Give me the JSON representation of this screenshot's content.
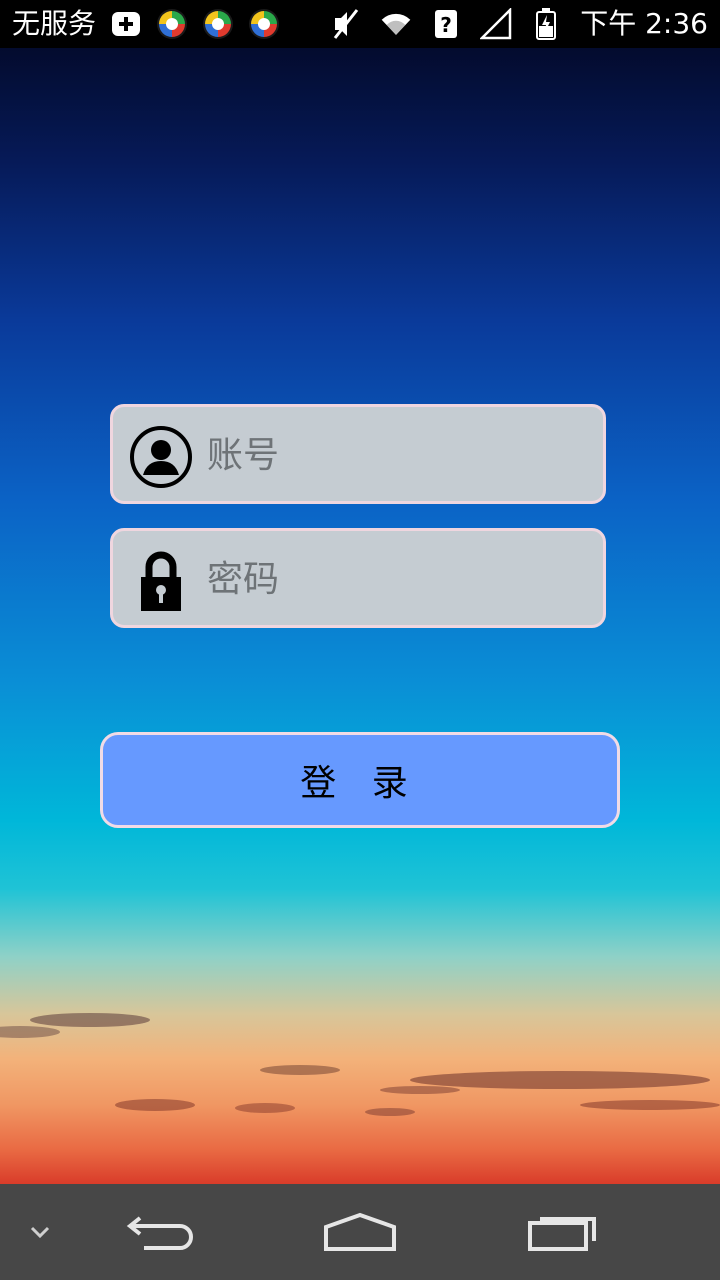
{
  "status_bar": {
    "carrier": "无服务",
    "time": "下午 2:36",
    "icons": [
      "plus-notification-icon",
      "app-icon",
      "app-icon",
      "app-icon",
      "mute-icon",
      "wifi-icon",
      "data-unknown-icon",
      "signal-icon",
      "battery-charging-icon"
    ]
  },
  "login": {
    "account_placeholder": "账号",
    "password_placeholder": "密码",
    "login_label": "登 录"
  },
  "colors": {
    "field_bg": "#c5ccd2",
    "field_border": "#efd6df",
    "button_bg": "#6699ff",
    "navbar_bg": "#474747"
  },
  "navigation": [
    "collapse-icon",
    "back-icon",
    "home-icon",
    "recents-icon"
  ]
}
